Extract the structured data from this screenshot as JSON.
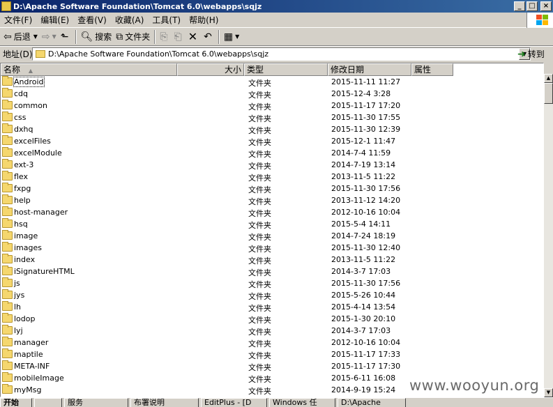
{
  "window": {
    "title": "D:\\Apache Software Foundation\\Tomcat 6.0\\webapps\\sqjz",
    "min": "_",
    "max": "□",
    "close": "×"
  },
  "menu": [
    "文件(F)",
    "编辑(E)",
    "查看(V)",
    "收藏(A)",
    "工具(T)",
    "帮助(H)"
  ],
  "toolbar": {
    "back": "后退",
    "search": "搜索",
    "folders": "文件夹"
  },
  "address": {
    "label": "地址(D)",
    "value": "D:\\Apache Software Foundation\\Tomcat 6.0\\webapps\\sqjz",
    "go": "转到"
  },
  "columns": {
    "name": "名称",
    "size": "大小",
    "type": "类型",
    "modified": "修改日期",
    "attributes": "属性"
  },
  "files": [
    {
      "name": "Android",
      "type": "文件夹",
      "date": "2015-11-11 11:27"
    },
    {
      "name": "cdq",
      "type": "文件夹",
      "date": "2015-12-4 3:28"
    },
    {
      "name": "common",
      "type": "文件夹",
      "date": "2015-11-17 17:20"
    },
    {
      "name": "css",
      "type": "文件夹",
      "date": "2015-11-30 17:55"
    },
    {
      "name": "dxhq",
      "type": "文件夹",
      "date": "2015-11-30 12:39"
    },
    {
      "name": "excelFiles",
      "type": "文件夹",
      "date": "2015-12-1 11:47"
    },
    {
      "name": "excelModule",
      "type": "文件夹",
      "date": "2014-7-4 11:59"
    },
    {
      "name": "ext-3",
      "type": "文件夹",
      "date": "2014-7-19 13:14"
    },
    {
      "name": "flex",
      "type": "文件夹",
      "date": "2013-11-5 11:22"
    },
    {
      "name": "fxpg",
      "type": "文件夹",
      "date": "2015-11-30 17:56"
    },
    {
      "name": "help",
      "type": "文件夹",
      "date": "2013-11-12 14:20"
    },
    {
      "name": "host-manager",
      "type": "文件夹",
      "date": "2012-10-16 10:04"
    },
    {
      "name": "hsq",
      "type": "文件夹",
      "date": "2015-5-4 14:11"
    },
    {
      "name": "image",
      "type": "文件夹",
      "date": "2014-7-24 18:19"
    },
    {
      "name": "images",
      "type": "文件夹",
      "date": "2015-11-30 12:40"
    },
    {
      "name": "index",
      "type": "文件夹",
      "date": "2013-11-5 11:22"
    },
    {
      "name": "iSignatureHTML",
      "type": "文件夹",
      "date": "2014-3-7 17:03"
    },
    {
      "name": "js",
      "type": "文件夹",
      "date": "2015-11-30 17:56"
    },
    {
      "name": "jys",
      "type": "文件夹",
      "date": "2015-5-26 10:44"
    },
    {
      "name": "lh",
      "type": "文件夹",
      "date": "2015-4-14 13:54"
    },
    {
      "name": "lodop",
      "type": "文件夹",
      "date": "2015-1-30 20:10"
    },
    {
      "name": "lyj",
      "type": "文件夹",
      "date": "2014-3-7 17:03"
    },
    {
      "name": "manager",
      "type": "文件夹",
      "date": "2012-10-16 10:04"
    },
    {
      "name": "maptile",
      "type": "文件夹",
      "date": "2015-11-17 17:33"
    },
    {
      "name": "META-INF",
      "type": "文件夹",
      "date": "2015-11-17 17:30"
    },
    {
      "name": "mobileImage",
      "type": "文件夹",
      "date": "2015-6-11 16:08"
    },
    {
      "name": "myMsg",
      "type": "文件夹",
      "date": "2014-9-19 15:24"
    }
  ],
  "taskbar": [
    "开始",
    "服务",
    "布署说明",
    "EditPlus - [D",
    "Windows 任",
    "D:\\Apache"
  ],
  "watermark": "www.wooyun.org"
}
